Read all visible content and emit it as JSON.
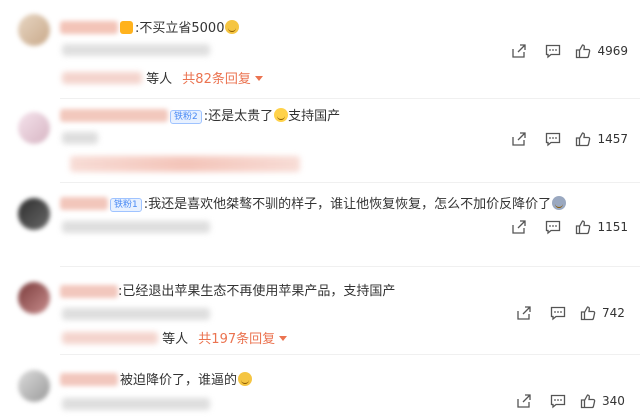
{
  "comments": [
    {
      "text": ":不买立省5000",
      "likes": "4969",
      "reply_prefix": "等人",
      "reply_more": "共82条回复"
    },
    {
      "badge": "铁粉2",
      "text": ":还是太贵了",
      "text_suffix": "支持国产",
      "likes": "1457"
    },
    {
      "badge": "铁粉1",
      "text": ":我还是喜欢他桀骜不驯的样子，谁让他恢复恢复，怎么不加价反降价了",
      "likes": "1151"
    },
    {
      "text": ":已经退出苹果生态不再使用苹果产品，支持国产",
      "likes": "742",
      "reply_prefix": "等人",
      "reply_more": "共197条回复"
    },
    {
      "text": "被迫降价了，谁逼的",
      "likes": "340"
    }
  ],
  "icons": [
    "share-icon",
    "comment-icon",
    "like-icon"
  ],
  "colors": {
    "accent": "#eb7350",
    "text": "#333333",
    "icon": "#555555",
    "badge": "#4a8af4"
  }
}
